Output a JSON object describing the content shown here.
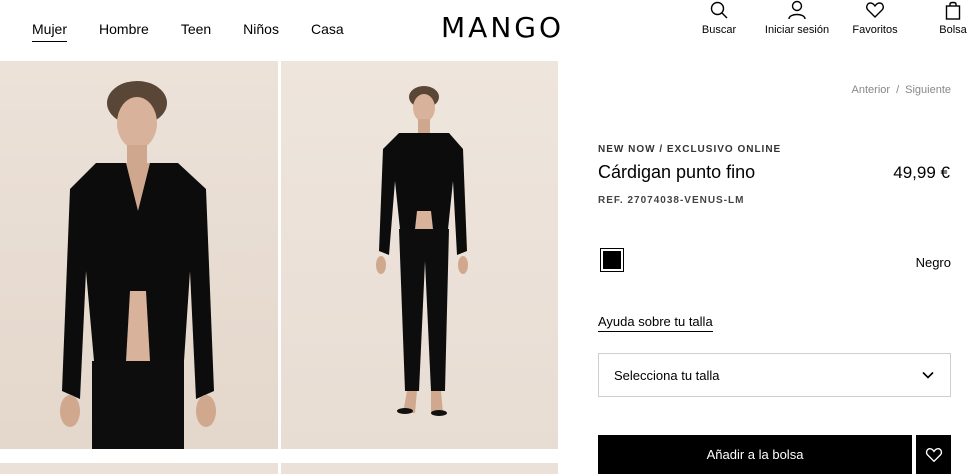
{
  "nav": {
    "items": [
      {
        "label": "Mujer",
        "active": true
      },
      {
        "label": "Hombre"
      },
      {
        "label": "Teen"
      },
      {
        "label": "Niños"
      },
      {
        "label": "Casa"
      }
    ]
  },
  "brand": {
    "logo": "MANGO"
  },
  "actions": {
    "search": {
      "label": "Buscar",
      "icon": "search-icon"
    },
    "login": {
      "label": "Iniciar sesión",
      "icon": "user-icon"
    },
    "favorites": {
      "label": "Favoritos",
      "icon": "heart-icon"
    },
    "bag": {
      "label": "Bolsa",
      "icon": "bag-icon"
    }
  },
  "pager": {
    "prev": "Anterior",
    "separator": "/",
    "next": "Siguiente"
  },
  "product": {
    "eyebrow": "NEW NOW / EXCLUSIVO ONLINE",
    "title": "Cárdigan punto fino",
    "price": "49,99 €",
    "ref": "REF. 27074038-VENUS-LM",
    "color": {
      "name": "Negro",
      "swatch": "#000000"
    },
    "size_help": "Ayuda sobre tu talla",
    "size_select": {
      "placeholder": "Selecciona tu talla"
    },
    "add_to_bag": "Añadir a la bolsa"
  },
  "colors": {
    "accent": "#000000",
    "photo_bg": "#e9ddd3"
  }
}
